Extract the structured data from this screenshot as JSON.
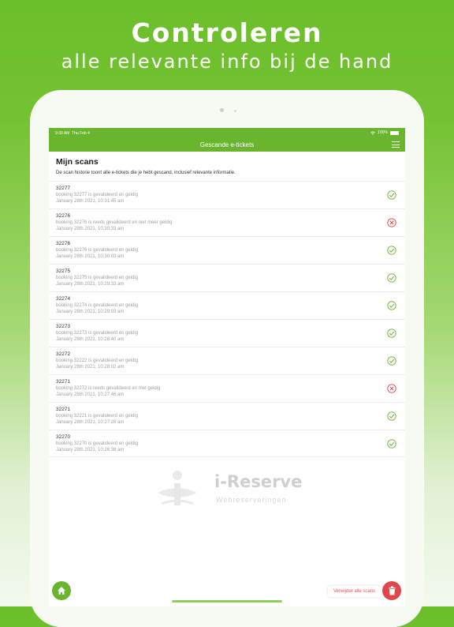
{
  "hero": {
    "title": "Controleren",
    "subtitle": "alle relevante info bij de hand"
  },
  "statusbar": {
    "time": "9:39 AM",
    "date": "Thu Feb 4",
    "battery": "100%"
  },
  "navbar": {
    "title": "Gescande e-tickets",
    "menu_icon": "hamburger-menu-icon"
  },
  "page": {
    "title": "Mijn scans",
    "description": "De scan historie toont alle e-tickets die je hebt gescand, inclusief relevante informatie."
  },
  "scans": [
    {
      "id": "32277",
      "message": "booking 32277 is gevalideerd en geldig",
      "date": "January 28th 2021, 10:31:45 am",
      "status": "valid"
    },
    {
      "id": "32276",
      "message": "booking 32276 is reeds gevalideerd en niet meer geldig",
      "date": "January 28th 2021, 10:30:33 am",
      "status": "invalid"
    },
    {
      "id": "32276",
      "message": "booking 32276 is gevalideerd en geldig",
      "date": "January 28th 2021, 10:30:03 am",
      "status": "valid"
    },
    {
      "id": "32275",
      "message": "booking 32275 is gevalideerd en geldig",
      "date": "January 28th 2021, 10:29:33 am",
      "status": "valid"
    },
    {
      "id": "32274",
      "message": "booking 32274 is gevalideerd en geldig",
      "date": "January 28th 2021, 10:29:03 am",
      "status": "valid"
    },
    {
      "id": "32273",
      "message": "booking 32273 is gevalideerd en geldig",
      "date": "January 28th 2021, 10:28:40 am",
      "status": "valid"
    },
    {
      "id": "32272",
      "message": "booking 32222 is gevalideerd en geldig",
      "date": "January 28th 2021, 10:28:02 am",
      "status": "valid"
    },
    {
      "id": "32271",
      "message": "booking 32272 is reeds gevalideerd en met geldig",
      "date": "January 28th 2021, 10:27:46 am",
      "status": "invalid"
    },
    {
      "id": "32271",
      "message": "booking 32221 is gevalideerd en geldig",
      "date": "January 28th 2021, 10:27:26 am",
      "status": "valid"
    },
    {
      "id": "32270",
      "message": "booking 32270 is gevalideerd en geldig",
      "date": "January 28th 2021, 10:26:38 am",
      "status": "valid"
    }
  ],
  "logo": {
    "name": "i-Reserve",
    "tagline": "Webreserveringen"
  },
  "actions": {
    "delete_all_label": "Verwijder alle scans",
    "home_icon": "home-icon",
    "delete_icon": "trash-icon"
  },
  "colors": {
    "brand_green": "#6ab52e",
    "valid": "#6ab52e",
    "invalid": "#e0474a"
  }
}
